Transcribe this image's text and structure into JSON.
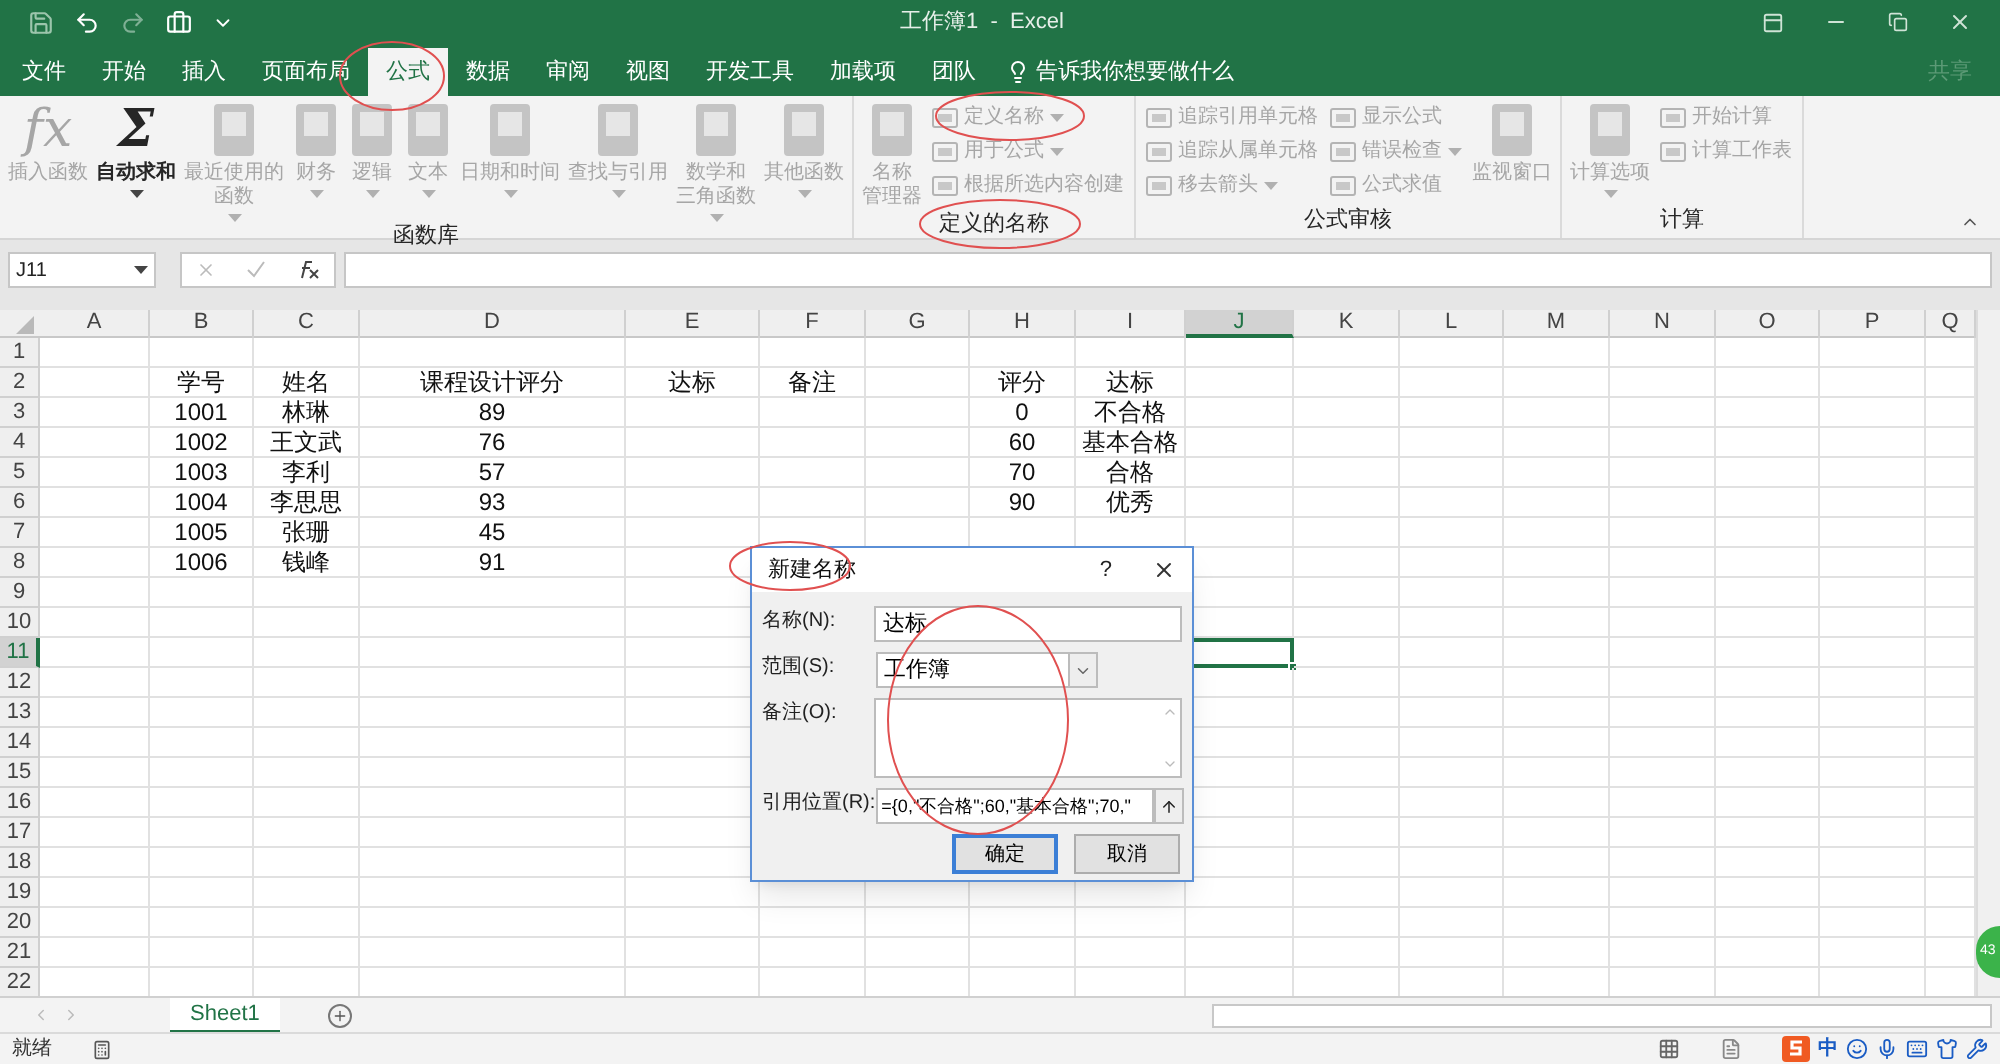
{
  "window": {
    "title": "工作簿1  -  Excel"
  },
  "menu_tabs": [
    {
      "label": "文件",
      "selected": false
    },
    {
      "label": "开始",
      "selected": false
    },
    {
      "label": "插入",
      "selected": false
    },
    {
      "label": "页面布局",
      "selected": false
    },
    {
      "label": "公式",
      "selected": true
    },
    {
      "label": "数据",
      "selected": false
    },
    {
      "label": "审阅",
      "selected": false
    },
    {
      "label": "视图",
      "selected": false
    },
    {
      "label": "开发工具",
      "selected": false
    },
    {
      "label": "加载项",
      "selected": false
    },
    {
      "label": "团队",
      "selected": false
    }
  ],
  "tell_me": "告诉我你想要做什么",
  "share": "共享",
  "ribbon_groups": [
    {
      "title": "函数库",
      "items": [
        {
          "kind": "glyph",
          "glyph": "fx",
          "lines": [
            "插入函数"
          ],
          "disabled": true,
          "caret": false
        },
        {
          "kind": "glyph",
          "glyph": "Σ",
          "lines": [
            "自动求和"
          ],
          "disabled": false,
          "caret": true
        },
        {
          "kind": "book",
          "lines": [
            "最近使用的",
            "函数"
          ],
          "disabled": true,
          "caret": true
        },
        {
          "kind": "book",
          "lines": [
            "财务"
          ],
          "disabled": true,
          "caret": true
        },
        {
          "kind": "book",
          "lines": [
            "逻辑"
          ],
          "disabled": true,
          "caret": true
        },
        {
          "kind": "book",
          "lines": [
            "文本"
          ],
          "disabled": true,
          "caret": true
        },
        {
          "kind": "book",
          "lines": [
            "日期和时间"
          ],
          "disabled": true,
          "caret": true
        },
        {
          "kind": "book",
          "lines": [
            "查找与引用"
          ],
          "disabled": true,
          "caret": true
        },
        {
          "kind": "book",
          "lines": [
            "数学和",
            "三角函数"
          ],
          "disabled": true,
          "caret": true
        },
        {
          "kind": "book",
          "lines": [
            "其他函数"
          ],
          "disabled": true,
          "caret": true
        }
      ]
    },
    {
      "title": "定义的名称",
      "items": [
        {
          "kind": "book",
          "lines": [
            "名称",
            "管理器"
          ],
          "disabled": true,
          "caret": false
        },
        {
          "kind": "stack",
          "rows": [
            {
              "label": "定义名称",
              "disabled": true,
              "caret": true
            },
            {
              "label": "用于公式",
              "disabled": true,
              "caret": true
            },
            {
              "label": "根据所选内容创建",
              "disabled": true,
              "caret": false
            }
          ]
        }
      ]
    },
    {
      "title": "公式审核",
      "items": [
        {
          "kind": "stack",
          "rows": [
            {
              "label": "追踪引用单元格",
              "disabled": true,
              "caret": false
            },
            {
              "label": "追踪从属单元格",
              "disabled": true,
              "caret": false
            },
            {
              "label": "移去箭头",
              "disabled": true,
              "caret": true
            }
          ]
        },
        {
          "kind": "stack",
          "rows": [
            {
              "label": "显示公式",
              "disabled": true,
              "caret": false
            },
            {
              "label": "错误检查",
              "disabled": true,
              "caret": true
            },
            {
              "label": "公式求值",
              "disabled": true,
              "caret": false
            }
          ]
        },
        {
          "kind": "book",
          "lines": [
            "监视窗口"
          ],
          "disabled": true,
          "caret": false
        }
      ]
    },
    {
      "title": "计算",
      "items": [
        {
          "kind": "book",
          "lines": [
            "计算选项"
          ],
          "disabled": true,
          "caret": true
        },
        {
          "kind": "stack",
          "rows": [
            {
              "label": "开始计算",
              "disabled": true,
              "caret": false
            },
            {
              "label": "计算工作表",
              "disabled": true,
              "caret": false
            }
          ]
        }
      ]
    }
  ],
  "name_box": "J11",
  "columns": [
    {
      "label": "A",
      "selected": false
    },
    {
      "label": "B",
      "selected": false
    },
    {
      "label": "C",
      "selected": false
    },
    {
      "label": "D",
      "selected": false
    },
    {
      "label": "E",
      "selected": false
    },
    {
      "label": "F",
      "selected": false
    },
    {
      "label": "G",
      "selected": false
    },
    {
      "label": "H",
      "selected": false
    },
    {
      "label": "I",
      "selected": false
    },
    {
      "label": "J",
      "selected": true
    },
    {
      "label": "K",
      "selected": false
    },
    {
      "label": "L",
      "selected": false
    },
    {
      "label": "M",
      "selected": false
    },
    {
      "label": "N",
      "selected": false
    },
    {
      "label": "O",
      "selected": false
    },
    {
      "label": "P",
      "selected": false
    },
    {
      "label": "Q",
      "selected": false
    }
  ],
  "rows": [
    {
      "number": "1",
      "selected": false
    },
    {
      "number": "2",
      "selected": false,
      "col_b": "学号",
      "col_c": "姓名",
      "col_d": "课程设计评分",
      "col_e": "达标",
      "col_f": "备注",
      "col_h": "评分",
      "col_i": "达标"
    },
    {
      "number": "3",
      "selected": false,
      "col_b": "1001",
      "col_c": "林琳",
      "col_d": "89",
      "col_h": "0",
      "col_i": "不合格"
    },
    {
      "number": "4",
      "selected": false,
      "col_b": "1002",
      "col_c": "王文武",
      "col_d": "76",
      "col_h": "60",
      "col_i": "基本合格"
    },
    {
      "number": "5",
      "selected": false,
      "col_b": "1003",
      "col_c": "李利",
      "col_d": "57",
      "col_h": "70",
      "col_i": "合格"
    },
    {
      "number": "6",
      "selected": false,
      "col_b": "1004",
      "col_c": "李思思",
      "col_d": "93",
      "col_h": "90",
      "col_i": "优秀"
    },
    {
      "number": "7",
      "selected": false,
      "col_b": "1005",
      "col_c": "张珊",
      "col_d": "45"
    },
    {
      "number": "8",
      "selected": false,
      "col_b": "1006",
      "col_c": "钱峰",
      "col_d": "91"
    },
    {
      "number": "9",
      "selected": false
    },
    {
      "number": "10",
      "selected": false
    },
    {
      "number": "11",
      "selected": true
    },
    {
      "number": "12",
      "selected": false
    },
    {
      "number": "13",
      "selected": false
    },
    {
      "number": "14",
      "selected": false
    },
    {
      "number": "15",
      "selected": false
    },
    {
      "number": "16",
      "selected": false
    },
    {
      "number": "17",
      "selected": false
    },
    {
      "number": "18",
      "selected": false
    },
    {
      "number": "19",
      "selected": false
    },
    {
      "number": "20",
      "selected": false
    },
    {
      "number": "21",
      "selected": false
    },
    {
      "number": "22",
      "selected": false
    }
  ],
  "dialog": {
    "title": "新建名称",
    "help": "?",
    "fields": [
      {
        "kind": "text",
        "label": "名称(N):",
        "value": "达标"
      },
      {
        "kind": "select",
        "label": "范围(S):",
        "value": "工作簿"
      },
      {
        "kind": "textarea",
        "label": "备注(O):"
      },
      {
        "kind": "ref",
        "label": "引用位置(R):",
        "value": "={0,\"不合格\";60,\"基本合格\";70,\""
      }
    ],
    "buttons": [
      {
        "label": "确定",
        "default": true
      },
      {
        "label": "取消",
        "default": false
      }
    ]
  },
  "sheet_tabs": [
    {
      "label": "Sheet1",
      "selected": true
    }
  ],
  "float_badge": "43",
  "status": {
    "text": "就绪",
    "ime": "中"
  }
}
